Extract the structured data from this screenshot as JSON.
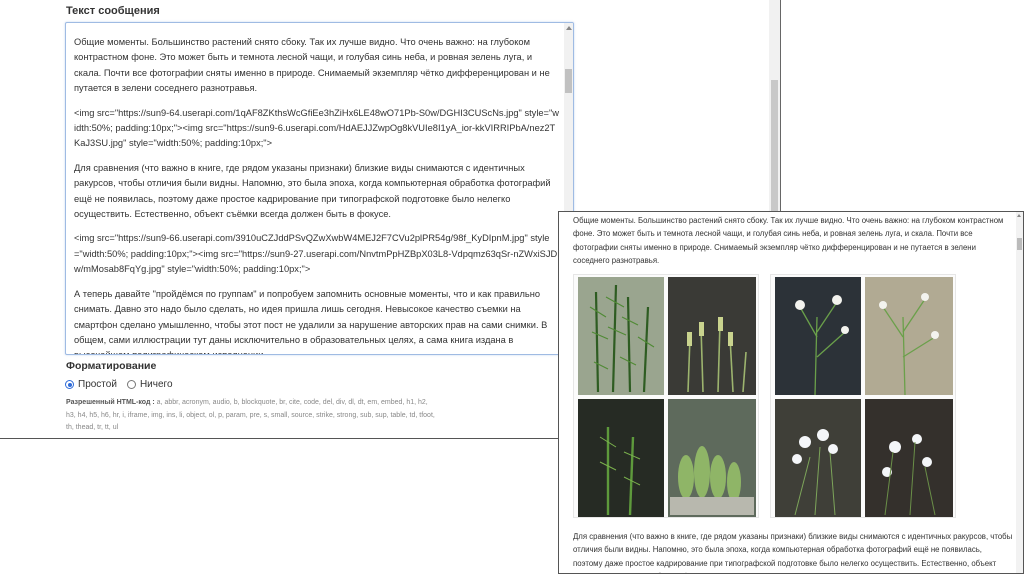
{
  "editor": {
    "field_title": "Текст сообщения",
    "paragraphs": [
      "Общие моменты. Большинство растений снято сбоку. Так их лучше видно. Что очень важно: на глубоком контрастном фоне. Это может быть и темнота лесной чащи, и голубая синь неба, и ровная зелень луга, и скала. Почти все фотографии сняты именно в природе. Снимаемый экземпляр чётко дифференцирован и не путается в зелени соседнего разнотравья.",
      "<img src=\"https://sun9-64.userapi.com/1qAF8ZKthsWcGfiEe3hZiHx6LE48wO71Pb-S0w/DGHI3CUScNs.jpg\" style=\"width:50%; padding:10px;\"><img src=\"https://sun9-6.userapi.com/HdAEJJZwpOg8kVUIe8I1yA_ior-kkVIRRIPbA/nez2TKaJ3SU.jpg\" style=\"width:50%; padding:10px;\">",
      "Для сравнения (что важно в книге, где рядом указаны признаки) близкие виды снимаются с идентичных ракурсов, чтобы отличия были видны. Напомню, это была эпоха, когда компьютерная обработка фотографий ещё не появилась, поэтому даже простое кадрирование при типографской подготовке было нелегко осуществить. Естественно, объект съёмки всегда должен быть в фокусе.",
      "<img src=\"https://sun9-66.userapi.com/3910uCZJddPSvQZwXwbW4MEJ2F7CVu2plPR54g/98f_KyDIpnM.jpg\" style=\"width:50%; padding:10px;\"><img src=\"https://sun9-27.userapi.com/NnvtmPpHZBpX03L8-Vdpqmz63qSr-nZWxiSJDw/mMosab8FqYg.jpg\" style=\"width:50%; padding:10px;\">",
      "А теперь давайте \"пройдёмся по группам\" и попробуем запомнить основные моменты, что и как правильно снимать. Давно это надо было сделать, но идея пришла лишь сегодня. Невысокое качество съемки на смартфон сделано умышленно, чтобы этот пост не удалили за нарушение авторских прав на сами снимки. В общем, сами иллюстрации тут даны исключительно в образовательных целях, а сама книга издана в высочайшем полиграфическом исполнении."
    ],
    "format_title": "Форматирование",
    "format_options": [
      "Простой",
      "Ничего"
    ],
    "allowed_label": "Разрешенный HTML-код :",
    "allowed_tags": "a, abbr, acronym, audio, b, blockquote, br, cite, code, del, div, dl, dt, em, embed, h1, h2, h3, h4, h5, h6, hr, i, iframe, img, ins, li, object, ol, p, param, pre, s, small, source, strike, strong, sub, sup, table, td, tfoot, th, thead, tr, tt, ul"
  },
  "preview": {
    "p1": "Общие моменты. Большинство растений снято сбоку. Так их лучше видно. Что очень важно: на глубоком контрастном фоне. Это может быть и темнота лесной чащи, и голубая синь неба, и ровная зелень луга, и скала. Почти все фотографии сняты именно в природе. Снимаемый экземпляр чётко дифференцирован и не путается в зелени соседнего разнотравья.",
    "p2": "Для сравнения (что важно в книге, где рядом указаны признаки) близкие виды снимаются с идентичных ракурсов, чтобы отличия были видны. Напомню, это была эпоха, когда компьютерная обработка фотографий ещё не появилась, поэтому даже простое кадрирование при типографской подготовке было нелегко осуществить. Естественно, объект съёмки всегда должен быть в фокусе."
  },
  "colors": {
    "accent": "#2f6bd8",
    "textarea_border": "#9fbbe3",
    "text": "#333333",
    "muted": "#888888"
  }
}
